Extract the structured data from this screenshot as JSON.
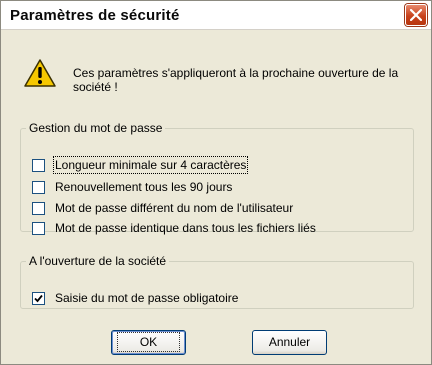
{
  "window": {
    "title": "Paramètres de sécurité",
    "close_icon": "close-icon"
  },
  "message": {
    "icon": "warning-icon",
    "text": "Ces paramètres s'appliqueront à la prochaine ouverture de la société !"
  },
  "password_group": {
    "legend": "Gestion du mot de passe",
    "options": [
      {
        "label": "Longueur minimale sur 4 caractères",
        "checked": false
      },
      {
        "label": "Renouvellement tous les 90 jours",
        "checked": false
      },
      {
        "label": "Mot de passe différent du nom de l'utilisateur",
        "checked": false
      },
      {
        "label": "Mot de passe identique dans tous les fichiers liés",
        "checked": false
      }
    ]
  },
  "opening_group": {
    "legend": "A l'ouverture de la société",
    "options": [
      {
        "label": "Saisie du mot de passe obligatoire",
        "checked": true
      }
    ]
  },
  "buttons": {
    "ok": "OK",
    "cancel": "Annuler"
  },
  "colors": {
    "close_button": "#c8421c",
    "warning_yellow": "#f6c800",
    "button_border": "#003c74"
  }
}
